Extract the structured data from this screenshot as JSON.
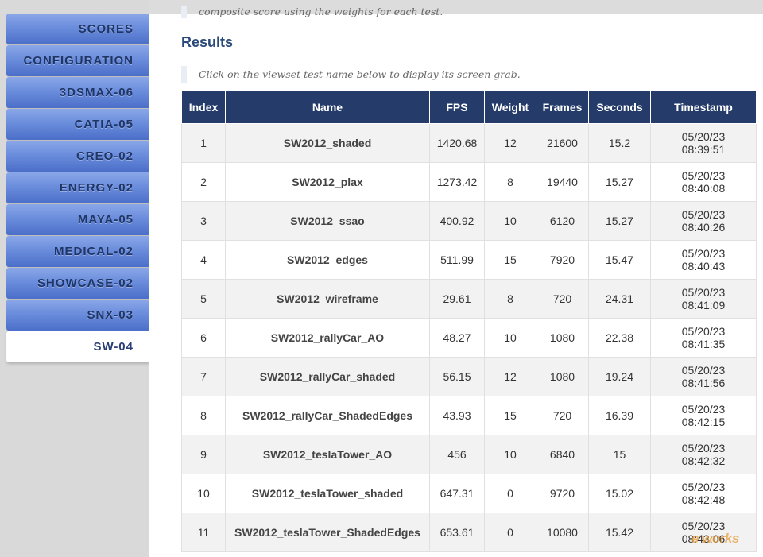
{
  "sidebar": {
    "items": [
      {
        "label": "SCORES",
        "active": false
      },
      {
        "label": "CONFIGURATION",
        "active": false
      },
      {
        "label": "3DSMAX-06",
        "active": false
      },
      {
        "label": "CATIA-05",
        "active": false
      },
      {
        "label": "CREO-02",
        "active": false
      },
      {
        "label": "ENERGY-02",
        "active": false
      },
      {
        "label": "MAYA-05",
        "active": false
      },
      {
        "label": "MEDICAL-02",
        "active": false
      },
      {
        "label": "SHOWCASE-02",
        "active": false
      },
      {
        "label": "SNX-03",
        "active": false
      },
      {
        "label": "SW-04",
        "active": true
      }
    ]
  },
  "main": {
    "note_top": "composite score using the weights for each test.",
    "results_title": "Results",
    "note_click": "Click on the viewset test name below to display its screen grab.",
    "table": {
      "headers": [
        "Index",
        "Name",
        "FPS",
        "Weight",
        "Frames",
        "Seconds",
        "Timestamp"
      ],
      "rows": [
        {
          "index": "1",
          "name": "SW2012_shaded",
          "fps": "1420.68",
          "weight": "12",
          "frames": "21600",
          "seconds": "15.2",
          "date": "05/20/23",
          "time": "08:39:51"
        },
        {
          "index": "2",
          "name": "SW2012_plax",
          "fps": "1273.42",
          "weight": "8",
          "frames": "19440",
          "seconds": "15.27",
          "date": "05/20/23",
          "time": "08:40:08"
        },
        {
          "index": "3",
          "name": "SW2012_ssao",
          "fps": "400.92",
          "weight": "10",
          "frames": "6120",
          "seconds": "15.27",
          "date": "05/20/23",
          "time": "08:40:26"
        },
        {
          "index": "4",
          "name": "SW2012_edges",
          "fps": "511.99",
          "weight": "15",
          "frames": "7920",
          "seconds": "15.47",
          "date": "05/20/23",
          "time": "08:40:43"
        },
        {
          "index": "5",
          "name": "SW2012_wireframe",
          "fps": "29.61",
          "weight": "8",
          "frames": "720",
          "seconds": "24.31",
          "date": "05/20/23",
          "time": "08:41:09"
        },
        {
          "index": "6",
          "name": "SW2012_rallyCar_AO",
          "fps": "48.27",
          "weight": "10",
          "frames": "1080",
          "seconds": "22.38",
          "date": "05/20/23",
          "time": "08:41:35"
        },
        {
          "index": "7",
          "name": "SW2012_rallyCar_shaded",
          "fps": "56.15",
          "weight": "12",
          "frames": "1080",
          "seconds": "19.24",
          "date": "05/20/23",
          "time": "08:41:56"
        },
        {
          "index": "8",
          "name": "SW2012_rallyCar_ShadedEdges",
          "fps": "43.93",
          "weight": "15",
          "frames": "720",
          "seconds": "16.39",
          "date": "05/20/23",
          "time": "08:42:15"
        },
        {
          "index": "9",
          "name": "SW2012_teslaTower_AO",
          "fps": "456",
          "weight": "10",
          "frames": "6840",
          "seconds": "15",
          "date": "05/20/23",
          "time": "08:42:32"
        },
        {
          "index": "10",
          "name": "SW2012_teslaTower_shaded",
          "fps": "647.31",
          "weight": "0",
          "frames": "9720",
          "seconds": "15.02",
          "date": "05/20/23",
          "time": "08:42:48"
        },
        {
          "index": "11",
          "name": "SW2012_teslaTower_ShadedEdges",
          "fps": "653.61",
          "weight": "0",
          "frames": "10080",
          "seconds": "15.42",
          "date": "05/20/23",
          "time": "08:43:06"
        }
      ]
    }
  },
  "watermark": "e works",
  "colors": {
    "header_bg": "#253c6b",
    "nav_gradient_top": "#8aa7e8",
    "nav_gradient_bottom": "#4b6fc9",
    "nav_text": "#1e3566",
    "title": "#2b4a7a"
  }
}
